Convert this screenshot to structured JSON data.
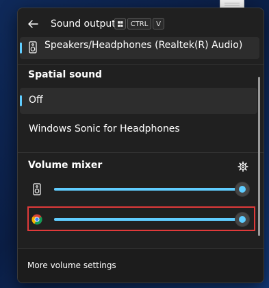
{
  "header": {
    "title": "Sound output",
    "shortcut_keys": [
      "CTRL",
      "V"
    ]
  },
  "output_device": {
    "label": "Speakers/Headphones (Realtek(R) Audio)",
    "icon": "speaker-icon"
  },
  "spatial_sound": {
    "title": "Spatial sound",
    "options": [
      {
        "label": "Off",
        "selected": true
      },
      {
        "label": "Windows Sonic for Headphones",
        "selected": false
      }
    ]
  },
  "volume_mixer": {
    "title": "Volume mixer",
    "settings_icon": "gear-icon",
    "items": [
      {
        "icon": "speaker-icon",
        "level": 0.98
      },
      {
        "icon": "chrome-icon",
        "level": 0.98
      }
    ]
  },
  "footer": {
    "link": "More volume settings"
  },
  "colors": {
    "accent": "#60cdff",
    "panel_bg": "#202020",
    "highlight": "#e03a3a"
  }
}
